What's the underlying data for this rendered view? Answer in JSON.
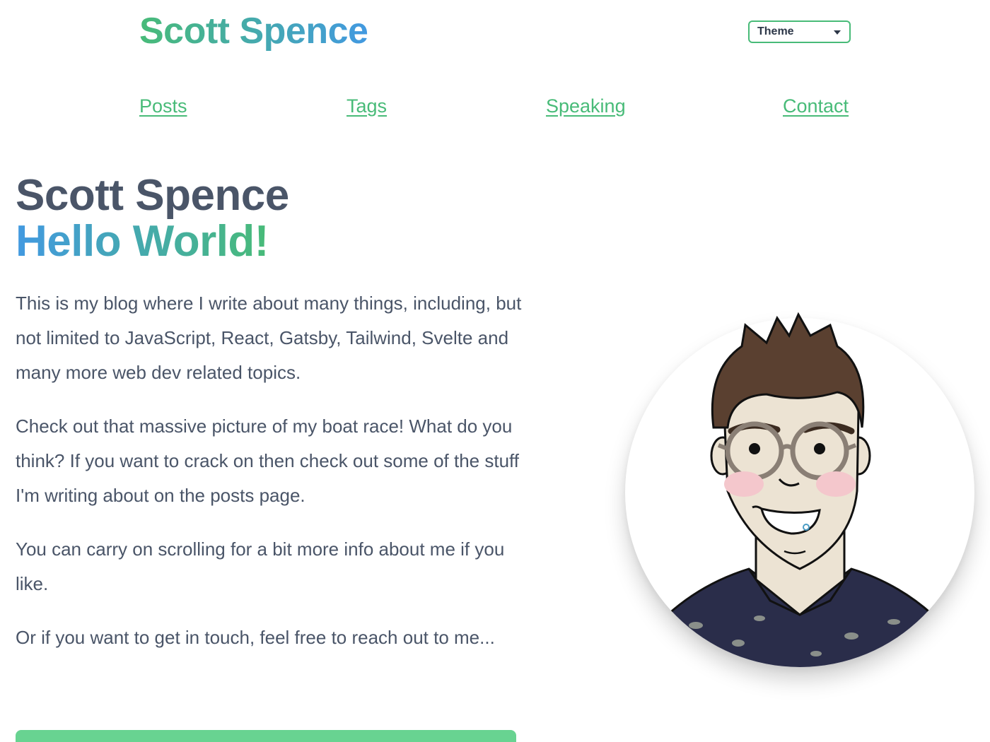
{
  "header": {
    "site_title": "Scott Spence",
    "theme_select": {
      "selected": "Theme",
      "icon": "chevron-down-icon"
    }
  },
  "nav": {
    "links": [
      {
        "label": "Posts"
      },
      {
        "label": "Tags"
      },
      {
        "label": "Speaking"
      },
      {
        "label": "Contact"
      }
    ]
  },
  "hero": {
    "name": "Scott Spence",
    "greeting": "Hello World!",
    "paragraphs": [
      "This is my blog where I write about many things, including, but not limited to JavaScript, React, Gatsby, Tailwind, Svelte and many more web dev related topics.",
      "Check out that massive picture of my boat race! What do you think? If you want to crack on then check out some of the stuff I'm writing about on the posts page.",
      "You can carry on scrolling for a bit more info about me if you like.",
      "Or if you want to get in touch, feel free to reach out to me..."
    ]
  },
  "colors": {
    "accent_green": "#48bb78",
    "accent_blue": "#4299e1",
    "text_gray": "#4a5568",
    "cta_green": "#68d391"
  },
  "avatar": {
    "icon": "cartoon-avatar-portrait"
  }
}
